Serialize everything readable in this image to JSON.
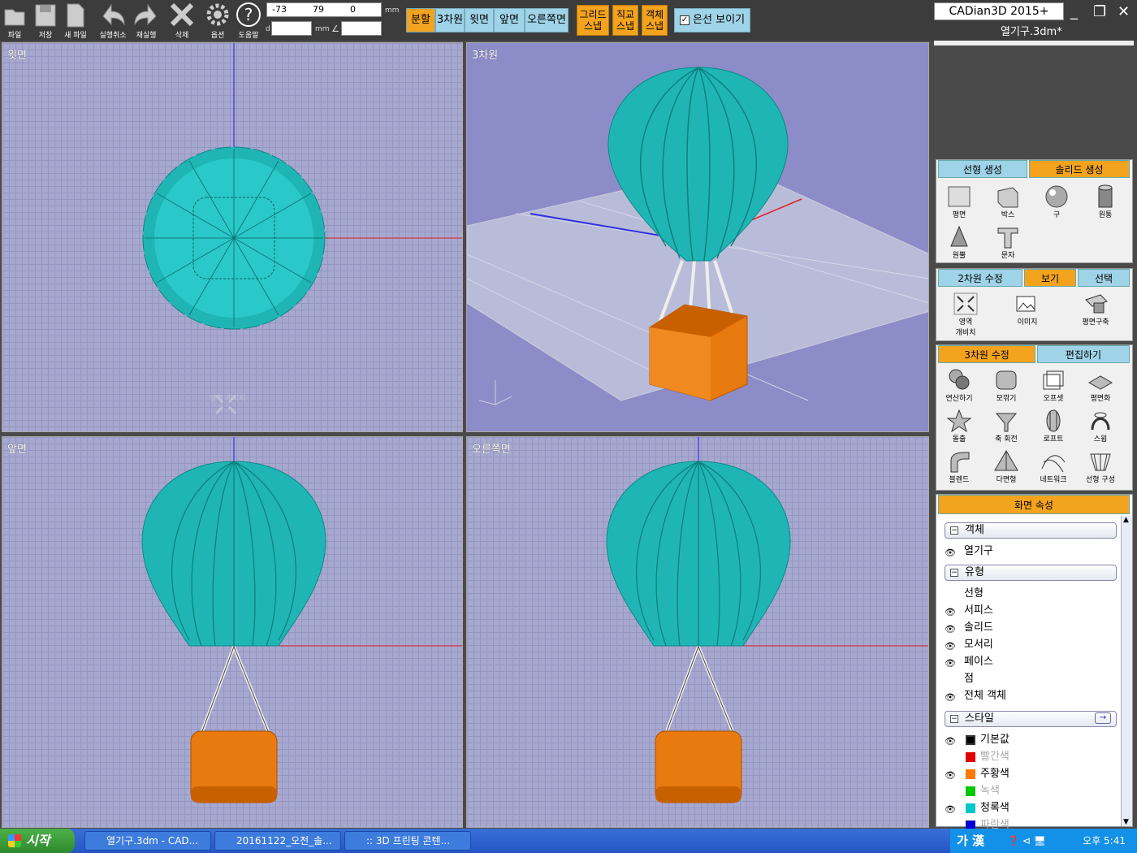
{
  "toolbar": {
    "buttons": [
      {
        "label": "파일",
        "icon": "folder-icon"
      },
      {
        "label": "저장",
        "icon": "save-icon"
      },
      {
        "label": "새 파일",
        "icon": "new-file-icon"
      },
      {
        "label": "실행취소",
        "icon": "undo-icon"
      },
      {
        "label": "재실행",
        "icon": "redo-icon"
      },
      {
        "label": "삭제",
        "icon": "delete-icon"
      },
      {
        "label": "옵션",
        "icon": "gear-icon"
      },
      {
        "label": "도움말",
        "icon": "help-icon"
      }
    ],
    "coords": {
      "x": "-73",
      "y": "79",
      "z": "0",
      "unit": "mm",
      "d_label": "d",
      "d_unit": "mm",
      "angle": "∠"
    },
    "view_buttons": [
      "분할",
      "3차원",
      "윗면",
      "앞면",
      "오른쪽면"
    ],
    "snap_buttons": [
      [
        "그리드",
        "스냅"
      ],
      [
        "직교",
        "스냅"
      ],
      [
        "객체",
        "스냅"
      ]
    ],
    "hidden_line": "은선 보이기"
  },
  "app": {
    "title": "CADian3D 2015+",
    "filename": "열기구.3dm*"
  },
  "viewports": {
    "top": "윗면",
    "three_d": "3차원",
    "front": "앞면",
    "right": "오른쪽면",
    "zoom_area_label": "영역 개비치"
  },
  "panel": {
    "create": {
      "tabs": [
        "선형 생성",
        "솔리드 생성"
      ],
      "tools": [
        "평면",
        "박스",
        "구",
        "원통",
        "원뿔",
        "문자"
      ]
    },
    "edit2d": {
      "tabs": [
        "2차원 수정",
        "보기",
        "선택"
      ],
      "tools": [
        [
          "영역",
          "개비치"
        ],
        [
          "이미지"
        ],
        [
          "평면구축"
        ]
      ]
    },
    "edit3d": {
      "tabs": [
        "3차원 수정",
        "편집하기"
      ],
      "tools": [
        "연산하기",
        "모깎기",
        "오프셋",
        "평면화",
        "돌출",
        "축 회전",
        "로프트",
        "스윕",
        "블렌드",
        "다면형",
        "네트워크",
        "선형 구성"
      ]
    },
    "props": {
      "header": "화면 속성",
      "object_section": "객체",
      "object_item": "열기구",
      "type_section": "유형",
      "types": [
        {
          "label": "선형",
          "eye": false
        },
        {
          "label": "서피스",
          "eye": true
        },
        {
          "label": "솔리드",
          "eye": true
        },
        {
          "label": "모서리",
          "eye": true
        },
        {
          "label": "페이스",
          "eye": true
        },
        {
          "label": "점",
          "eye": false
        },
        {
          "label": "전체 객체",
          "eye": true
        }
      ],
      "style_section": "스타일",
      "styles": [
        {
          "label": "기본값",
          "color": "#000000",
          "eye": true,
          "dim": false
        },
        {
          "label": "빨간색",
          "color": "#e00000",
          "eye": false,
          "dim": true
        },
        {
          "label": "주황색",
          "color": "#ff7a00",
          "eye": true,
          "dim": false
        },
        {
          "label": "녹색",
          "color": "#00c800",
          "eye": false,
          "dim": true
        },
        {
          "label": "청록색",
          "color": "#00c8c8",
          "eye": true,
          "dim": false
        },
        {
          "label": "파란색",
          "color": "#0000d0",
          "eye": false,
          "dim": true
        }
      ]
    }
  },
  "taskbar": {
    "start": "시작",
    "tasks": [
      "열기구.3dm - CAD...",
      "20161122_오전_솔...",
      ":: 3D 프린팅 콘텐..."
    ],
    "ime": "가 漢",
    "clock": "오후 5:41"
  },
  "colors": {
    "balloon": "#1fb5b5",
    "basket": "#e87a10",
    "accent": "#f4a31e",
    "tab": "#9fd3e8"
  }
}
